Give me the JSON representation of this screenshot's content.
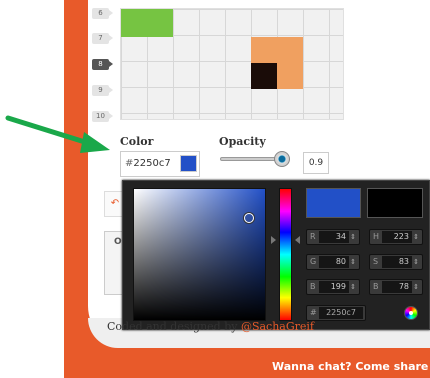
{
  "colors": {
    "accent": "#e85a2a",
    "selected_color": "#2250c7",
    "current_color": "#000000",
    "arrow": "#1aa84a"
  },
  "grid": {
    "row_labels": [
      "6",
      "7",
      "8",
      "9",
      "10"
    ],
    "active_row": "8",
    "cells": [
      {
        "color": "#76c442"
      },
      {
        "color": "#f0a060"
      },
      {
        "color": "#f0a060"
      },
      {
        "color": "#1a0c08"
      },
      {
        "color": "#f0a060"
      }
    ]
  },
  "color_section": {
    "label": "Color",
    "hash": "#",
    "value": "2250c7"
  },
  "opacity_section": {
    "label": "Opacity",
    "value": "0.9",
    "level": 0.9
  },
  "picker": {
    "fields": {
      "r_label": "R",
      "r_value": "34",
      "g_label": "G",
      "g_value": "80",
      "b_label": "B",
      "b_value": "199",
      "h_label": "H",
      "h_value": "223",
      "s_label": "S",
      "s_value": "83",
      "br_label": "B",
      "br_value": "78",
      "hex_label": "#",
      "hex_value": "2250c7"
    }
  },
  "background_panel": {
    "tab_label": "O",
    "button_icon": "undo-icon"
  },
  "footer": {
    "text": "Coded and designed by ",
    "handle": "@SachaGreif"
  },
  "bottom_bar": {
    "text": "Wanna chat? Come share yo"
  }
}
